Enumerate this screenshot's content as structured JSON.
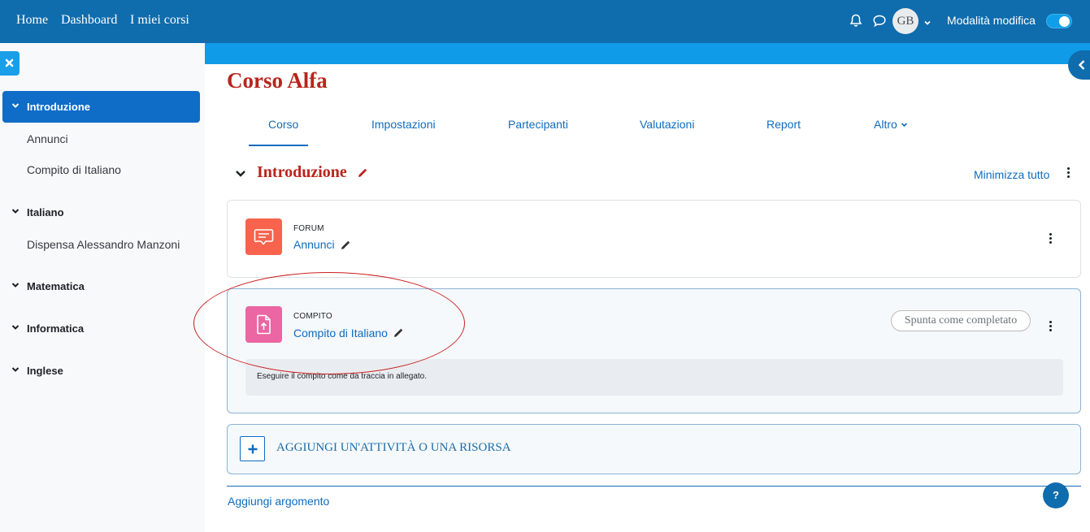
{
  "navbar": {
    "links": [
      "Home",
      "Dashboard",
      "I miei corsi"
    ],
    "icons": [
      "bell-icon",
      "chat-icon"
    ],
    "avatar_initials": "GB",
    "edit_mode_label": "Modalità modifica",
    "edit_mode_on": true
  },
  "drawer": {
    "sections": [
      {
        "label": "Introduzione",
        "active": true,
        "items": [
          "Annunci",
          "Compito di Italiano"
        ]
      },
      {
        "label": "Italiano",
        "active": false,
        "items": [
          "Dispensa Alessandro Manzoni"
        ]
      },
      {
        "label": "Matematica",
        "active": false,
        "items": []
      },
      {
        "label": "Informatica",
        "active": false,
        "items": []
      },
      {
        "label": "Inglese",
        "active": false,
        "items": []
      }
    ]
  },
  "course": {
    "title": "Corso Alfa",
    "tabs": [
      "Corso",
      "Impostazioni",
      "Partecipanti",
      "Valutazioni",
      "Report",
      "Altro"
    ],
    "active_tab": "Corso"
  },
  "section": {
    "title": "Introduzione",
    "collapse_all": "Minimizza tutto"
  },
  "activities": [
    {
      "type": "FORUM",
      "name": "Annunci",
      "icon": "forum-icon",
      "color": "#f7634d"
    },
    {
      "type": "COMPITO",
      "name": "Compito di Italiano",
      "icon": "assignment-icon",
      "color": "#eb66a2",
      "complete_button": "Spunta come completato",
      "description": "Eseguire il compito come da traccia in allegato."
    }
  ],
  "add_activity": "AGGIUNGI UN'ATTIVITÀ O UNA RISORSA",
  "add_topic": "Aggiungi argomento",
  "help": "?",
  "colors": {
    "navbar": "#0f6cad",
    "accent": "#0f6cbf",
    "title_red": "#b8251d",
    "strip": "#0f9be8"
  }
}
